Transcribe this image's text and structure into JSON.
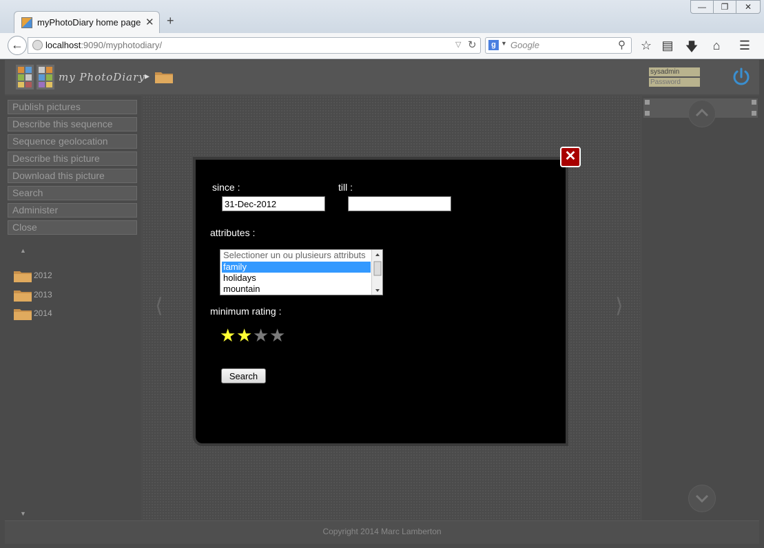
{
  "browser": {
    "tab_title": "myPhotoDiary home page",
    "tab_close_glyph": "✕",
    "new_tab_glyph": "+",
    "url_host": "localhost",
    "url_rest": ":9090/myphotodiary/",
    "search_placeholder": "Google",
    "search_engine_letter": "g",
    "window_buttons": {
      "minimize": "—",
      "maximize": "❐",
      "close": "✕"
    }
  },
  "header": {
    "logo_text": "my PhotoDiary",
    "login_user": "sysadmin",
    "login_password_placeholder": "Password"
  },
  "menu": {
    "items": [
      "Publish pictures",
      "Describe this sequence",
      "Sequence geolocation",
      "Describe this picture",
      "Download this picture",
      "Search",
      "Administer",
      "Close"
    ]
  },
  "tree": {
    "folders": [
      "2012",
      "2013",
      "2014"
    ]
  },
  "footer": {
    "copyright": "Copyright 2014 Marc Lamberton"
  },
  "search_dialog": {
    "since_label": "since :",
    "since_value": "31-Dec-2012",
    "till_label": "till :",
    "till_value": "",
    "attributes_label": "attributes :",
    "attribute_options": [
      "Selectioner un ou plusieurs attributs",
      "family",
      "holidays",
      "mountain"
    ],
    "selected_attribute": "family",
    "min_rating_label": "minimum rating :",
    "rating": {
      "value": 2,
      "max": 4
    },
    "search_button": "Search",
    "close_glyph": "✕"
  },
  "colors": {
    "star_on": "#ffff33",
    "star_off": "#7a7a7a",
    "selection": "#3399ff",
    "close_button": "#a80000",
    "power_icon": "#3a8fd0"
  }
}
